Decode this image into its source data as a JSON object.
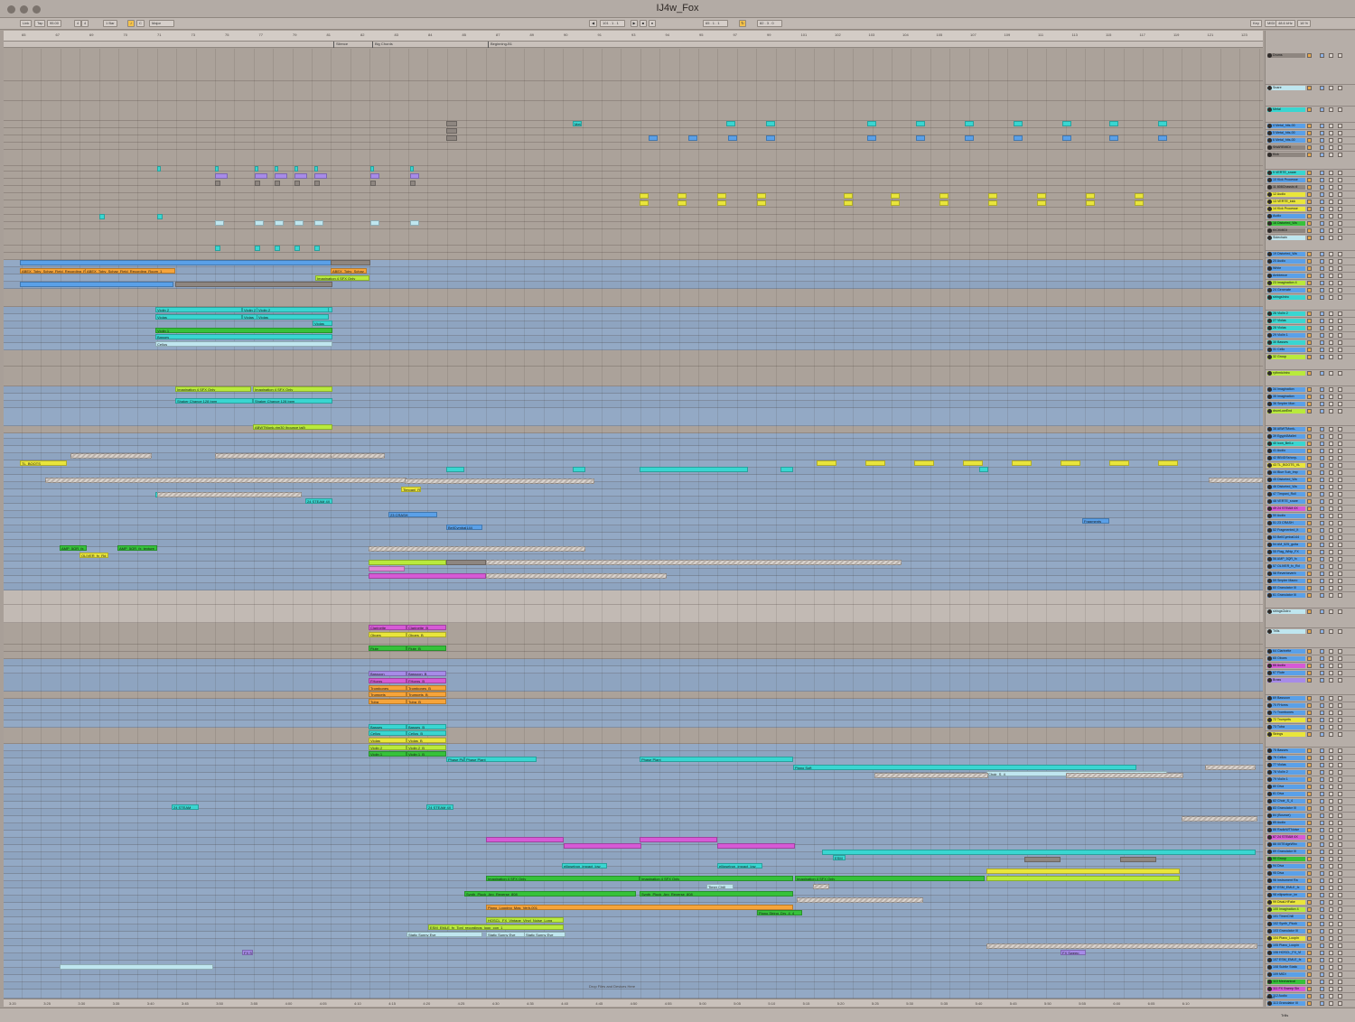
{
  "window": {
    "title": "IJ4w_Fox"
  },
  "toolbar": {
    "left": [
      "Link",
      "Tap",
      "95.00",
      "4",
      "4",
      "1 Bar",
      "C",
      "Major"
    ],
    "center": [
      "101 . 1 . 1",
      "65 . 1 . 1",
      "82 . 3 . 0"
    ],
    "right": [
      "Key",
      "MIDI",
      "48.6 kHz",
      "18 %"
    ]
  },
  "ruler": {
    "bars": [
      "65",
      "67",
      "69",
      "70",
      "71",
      "73",
      "75",
      "77",
      "79",
      "81",
      "82",
      "83",
      "84",
      "85",
      "87",
      "89",
      "90",
      "91",
      "93",
      "94",
      "95",
      "97",
      "99",
      "101",
      "102",
      "103",
      "104",
      "105",
      "107",
      "109",
      "111",
      "113",
      "115",
      "117",
      "119",
      "121",
      "123"
    ]
  },
  "locators": [
    "Silence",
    "Big Chords",
    "Beginning-B1"
  ],
  "time_labels": [
    "3:20",
    "3:25",
    "3:30",
    "3:35",
    "3:40",
    "3:45",
    "3:50",
    "3:55",
    "4:00",
    "4:05",
    "4:10",
    "4:15",
    "4:20",
    "4:25",
    "4:30",
    "4:35",
    "4:40",
    "4:45",
    "4:50",
    "4:55",
    "5:00",
    "5:05",
    "5:10",
    "5:15",
    "5:20",
    "5:25",
    "5:30",
    "5:35",
    "5:40",
    "5:45",
    "5:50",
    "5:55",
    "6:00",
    "6:05",
    "6:10"
  ],
  "drop_hint": "Drop Files and Devices Here",
  "colors": {
    "cyan": "#39d6d1",
    "blue": "#5aa0e8",
    "green": "#36c23a",
    "lime": "#b9ea3c",
    "yellow": "#e9e53b",
    "orange": "#f6a43a",
    "magenta": "#d65ad6",
    "purple": "#a78be8",
    "pale": "#bfe6ef",
    "grey": "#8e8680",
    "lane": "#8fa6c4"
  },
  "clips": [
    {
      "label": "ABEX_Toby_Schay_Field_Recording_Room_1",
      "color": "orange"
    },
    {
      "label": "ABEX_Toby_Schay_Field_Recording_Room_1",
      "color": "orange"
    },
    {
      "label": "ABEX_Toby_Schay_Fi",
      "color": "orange"
    },
    {
      "label": "Imagination 4 SFX Only",
      "color": "lime"
    },
    {
      "label": "Violin 2",
      "color": "cyan"
    },
    {
      "label": "Violin 2",
      "color": "cyan"
    },
    {
      "label": "Violin 2",
      "color": "cyan"
    },
    {
      "label": "Violas",
      "color": "cyan"
    },
    {
      "label": "Violas",
      "color": "cyan"
    },
    {
      "label": "Violas",
      "color": "cyan"
    },
    {
      "label": "Violas",
      "color": "cyan"
    },
    {
      "label": "Violin 1",
      "color": "green"
    },
    {
      "label": "Basses",
      "color": "cyan"
    },
    {
      "label": "Cellos",
      "color": "pale"
    },
    {
      "label": "Imagination 4 SFX Only",
      "color": "lime"
    },
    {
      "label": "Imagination 4 SFX Only",
      "color": "lime"
    },
    {
      "label": "Shaker Chance 128 bpm",
      "color": "cyan"
    },
    {
      "label": "Shaker Chance 128 bpm",
      "color": "cyan"
    },
    {
      "label": "ABWTMonk-rim30 (bounce tail)",
      "color": "lime"
    },
    {
      "label": "TL_BOOTS",
      "color": "yellow"
    },
    {
      "label": "Timpani_R",
      "color": "yellow"
    },
    {
      "label": "VERTE",
      "color": "cyan"
    },
    {
      "label": "24 STEAM 4X",
      "color": "cyan"
    },
    {
      "label": "23 CRASH",
      "color": "blue"
    },
    {
      "label": "BellCymbal144",
      "color": "blue"
    },
    {
      "label": "AMP_5QR_fx",
      "color": "green"
    },
    {
      "label": "AMP_5QR_fx_texture",
      "color": "green"
    },
    {
      "label": "OLIVER_fx_Rd",
      "color": "yellow"
    },
    {
      "label": "Clarinette",
      "color": "magenta"
    },
    {
      "label": "Clarinette_B",
      "color": "magenta"
    },
    {
      "label": "Oboes",
      "color": "yellow"
    },
    {
      "label": "Oboes_B",
      "color": "yellow"
    },
    {
      "label": "Flute",
      "color": "green"
    },
    {
      "label": "Flute_B",
      "color": "green"
    },
    {
      "label": "Bassoon",
      "color": "purple"
    },
    {
      "label": "Bassoon_B",
      "color": "purple"
    },
    {
      "label": "FHorns",
      "color": "magenta"
    },
    {
      "label": "FHorns_B",
      "color": "magenta"
    },
    {
      "label": "Trombones",
      "color": "orange"
    },
    {
      "label": "Trombones_B",
      "color": "orange"
    },
    {
      "label": "Trumpets",
      "color": "orange"
    },
    {
      "label": "Trumpets_B",
      "color": "orange"
    },
    {
      "label": "Tuba",
      "color": "orange"
    },
    {
      "label": "Tuba_B",
      "color": "orange"
    },
    {
      "label": "Basses",
      "color": "cyan"
    },
    {
      "label": "Basses_B",
      "color": "cyan"
    },
    {
      "label": "Cellos",
      "color": "cyan"
    },
    {
      "label": "Cellos_B",
      "color": "cyan"
    },
    {
      "label": "Violas",
      "color": "yellow"
    },
    {
      "label": "Violas_B",
      "color": "yellow"
    },
    {
      "label": "Violin 2",
      "color": "lime"
    },
    {
      "label": "Violin 2_B",
      "color": "lime"
    },
    {
      "label": "Violin 1",
      "color": "green"
    },
    {
      "label": "Violin 1_B",
      "color": "green"
    },
    {
      "label": "Phase Plan",
      "color": "cyan"
    },
    {
      "label": "Phase Plant",
      "color": "cyan"
    },
    {
      "label": "Phase Plant",
      "color": "cyan"
    },
    {
      "label": "Piano Soft",
      "color": "cyan"
    },
    {
      "label": "Choir_S_4",
      "color": "pale"
    },
    {
      "label": "24 STEAM",
      "color": "cyan"
    },
    {
      "label": "24 STEAM 4X",
      "color": "cyan"
    },
    {
      "label": "Imagination 4 SFX Only",
      "color": "green"
    },
    {
      "label": "Imagination 4 SFX Only",
      "color": "green"
    },
    {
      "label": "Imagination 4 SFX Only",
      "color": "green"
    },
    {
      "label": "Synth_Pluck_Arp_Reverse_808",
      "color": "green"
    },
    {
      "label": "Synth_Pluck_Arp_Reverse_808",
      "color": "green"
    },
    {
      "label": "Piano_Looping_Mas_Verb-001",
      "color": "orange"
    },
    {
      "label": "HOSCL_FX_Vintage_Vinyl_Noise_Long",
      "color": "lime"
    },
    {
      "label": "ESM_EMLE_fx_Tonl_recordings_loop_con_1",
      "color": "lime"
    },
    {
      "label": "Static Sunny Eve",
      "color": "pale"
    },
    {
      "label": "Static Sunny Eve",
      "color": "pale"
    },
    {
      "label": "Static Sunny Eve",
      "color": "pale"
    },
    {
      "label": "Piano String_Dry_4_4",
      "color": "green"
    },
    {
      "label": "ellipsetron_impact_low",
      "color": "cyan"
    },
    {
      "label": "ellipsetron_impact_low",
      "color": "cyan"
    },
    {
      "label": "Timer Chill",
      "color": "pale"
    },
    {
      "label": "Fragments",
      "color": "blue"
    },
    {
      "label": "Metal",
      "color": "cyan"
    },
    {
      "label": "VERT",
      "color": "yellow"
    },
    {
      "label": "ESM",
      "color": "cyan"
    },
    {
      "label": "FX Swe",
      "color": "purple"
    },
    {
      "label": "FX Sweep",
      "color": "purple"
    }
  ],
  "mixer_tracks": [
    {
      "name": "Drums",
      "color": "grey"
    },
    {
      "name": "Snare",
      "color": "pale"
    },
    {
      "name": "Metal",
      "color": "cyan"
    },
    {
      "name": "4 Metal_hits-00",
      "color": "blue"
    },
    {
      "name": "5 Metal_hits-00",
      "color": "blue"
    },
    {
      "name": "6 Metal_hits-00",
      "color": "blue"
    },
    {
      "name": "SNAREMIDI",
      "color": "grey"
    },
    {
      "name": "Kick",
      "color": "grey"
    },
    {
      "name": "9 VERTE_snare",
      "color": "cyan"
    },
    {
      "name": "10 Kick Processe",
      "color": "blue"
    },
    {
      "name": "11 808Chassis di",
      "color": "grey"
    },
    {
      "name": "12 Audio",
      "color": "yellow"
    },
    {
      "name": "13 VERTE_kick",
      "color": "yellow"
    },
    {
      "name": "14 Kick Processe",
      "color": "yellow"
    },
    {
      "name": "Audio",
      "color": "blue"
    },
    {
      "name": "16 Distorted_Wa",
      "color": "green"
    },
    {
      "name": "KICKMIDI",
      "color": "grey"
    },
    {
      "name": "Sidechain",
      "color": "pale"
    },
    {
      "name": "19 Distorted_Wa",
      "color": "blue"
    },
    {
      "name": "20 Audio",
      "color": "blue"
    },
    {
      "name": "White",
      "color": "blue"
    },
    {
      "name": "Ambience",
      "color": "blue"
    },
    {
      "name": "23 Imagination 4",
      "color": "lime"
    },
    {
      "name": "24 Generate",
      "color": "blue"
    },
    {
      "name": "stringsIntro",
      "color": "cyan"
    },
    {
      "name": "26 Violin 2",
      "color": "cyan"
    },
    {
      "name": "27 Violas",
      "color": "cyan"
    },
    {
      "name": "28 Violas",
      "color": "cyan"
    },
    {
      "name": "29 Violin 1",
      "color": "blue"
    },
    {
      "name": "30 Basses",
      "color": "cyan"
    },
    {
      "name": "31 Cello",
      "color": "blue"
    },
    {
      "name": "32 Group",
      "color": "lime"
    },
    {
      "name": "rythmicIntro",
      "color": "lime"
    },
    {
      "name": "34 Imagination",
      "color": "blue"
    },
    {
      "name": "35 Imagination",
      "color": "blue"
    },
    {
      "name": "36 Smpler Mon",
      "color": "blue"
    },
    {
      "name": "drumLowEnd",
      "color": "lime"
    },
    {
      "name": "38 ABWTMonk-",
      "color": "blue"
    },
    {
      "name": "39 Egypt4Mallet",
      "color": "blue"
    },
    {
      "name": "40 Icon_Bell-c",
      "color": "cyan"
    },
    {
      "name": "41 Audio",
      "color": "blue"
    },
    {
      "name": "42 BB4DSshorp-",
      "color": "blue"
    },
    {
      "name": "43 TL_BOOTS_VL",
      "color": "yellow"
    },
    {
      "name": "44 Blue Sub_Imp",
      "color": "blue"
    },
    {
      "name": "45 Distorted_Wa",
      "color": "blue"
    },
    {
      "name": "46 Distorted_Wa",
      "color": "blue"
    },
    {
      "name": "47 Timpani_Roll",
      "color": "blue"
    },
    {
      "name": "48 VERTE_snare",
      "color": "blue"
    },
    {
      "name": "49 24 STEAM 4X",
      "color": "magenta"
    },
    {
      "name": "50 Audio",
      "color": "blue"
    },
    {
      "name": "51 23 CRASH",
      "color": "blue"
    },
    {
      "name": "52 Fragmented_It",
      "color": "blue"
    },
    {
      "name": "53 BellCymbal144",
      "color": "blue"
    },
    {
      "name": "54 AM_525_guita",
      "color": "blue"
    },
    {
      "name": "55 Flag_Whip_FX",
      "color": "blue"
    },
    {
      "name": "56 AMP_5QR_fx",
      "color": "blue"
    },
    {
      "name": "57 OLIVER_fx_Rd",
      "color": "blue"
    },
    {
      "name": "58 Reverbeverb",
      "color": "blue"
    },
    {
      "name": "59 Smpler Macro",
      "color": "blue"
    },
    {
      "name": "60 Granulator III",
      "color": "blue"
    },
    {
      "name": "61 Granulator III",
      "color": "blue"
    },
    {
      "name": "stringsOutro",
      "color": "pale"
    },
    {
      "name": "Trills",
      "color": "pale"
    },
    {
      "name": "64 Clarinette",
      "color": "blue"
    },
    {
      "name": "65 Oboes",
      "color": "blue"
    },
    {
      "name": "66 Audio",
      "color": "magenta"
    },
    {
      "name": "67 Flute",
      "color": "blue"
    },
    {
      "name": "Brass",
      "color": "purple"
    },
    {
      "name": "69 Bassoon",
      "color": "blue"
    },
    {
      "name": "70 FHorns",
      "color": "blue"
    },
    {
      "name": "71 Trombones",
      "color": "blue"
    },
    {
      "name": "72 Trumpets",
      "color": "yellow"
    },
    {
      "name": "73 Tuba",
      "color": "blue"
    },
    {
      "name": "Strings",
      "color": "yellow"
    },
    {
      "name": "75 Basses",
      "color": "blue"
    },
    {
      "name": "76 Cellos",
      "color": "blue"
    },
    {
      "name": "77 Violas",
      "color": "blue"
    },
    {
      "name": "78 Violin 2",
      "color": "blue"
    },
    {
      "name": "79 Violin 1",
      "color": "blue"
    },
    {
      "name": "80 Diva",
      "color": "blue"
    },
    {
      "name": "81 Diva",
      "color": "blue"
    },
    {
      "name": "82 Choir_S_4",
      "color": "blue"
    },
    {
      "name": "83 Granulator III",
      "color": "blue"
    },
    {
      "name": "84 (Bounce)",
      "color": "blue"
    },
    {
      "name": "85 Audio",
      "color": "blue"
    },
    {
      "name": "86 RadioWTNoise",
      "color": "blue"
    },
    {
      "name": "87 24 STEAM 4X",
      "color": "magenta"
    },
    {
      "name": "88 00TEdgeWhx",
      "color": "blue"
    },
    {
      "name": "89 Granulator III",
      "color": "blue"
    },
    {
      "name": "90 Group",
      "color": "green"
    },
    {
      "name": "94 Diva",
      "color": "blue"
    },
    {
      "name": "95 Diva",
      "color": "blue"
    },
    {
      "name": "96 Instrument Ra",
      "color": "blue"
    },
    {
      "name": "97 ESM_EMLE_fx",
      "color": "blue"
    },
    {
      "name": "98 ellipsetron_im",
      "color": "blue"
    },
    {
      "name": "99 DivaLHFake",
      "color": "yellow"
    },
    {
      "name": "100 Imagination 4",
      "color": "lime"
    },
    {
      "name": "101 TimerChill",
      "color": "blue"
    },
    {
      "name": "102 Synth_Pluck",
      "color": "blue"
    },
    {
      "name": "103 Granulator III",
      "color": "blue"
    },
    {
      "name": "104 Piano_Loopin",
      "color": "yellow"
    },
    {
      "name": "105 Piano_Loopin",
      "color": "blue"
    },
    {
      "name": "106 HOSCL_FX_Vi",
      "color": "blue"
    },
    {
      "name": "107 ESM_EMLE_fx",
      "color": "blue"
    },
    {
      "name": "108 Subtle Static",
      "color": "blue"
    },
    {
      "name": "109 MIDI",
      "color": "blue"
    },
    {
      "name": "110 Mechanical",
      "color": "green"
    },
    {
      "name": "111 FX Sweep Sin",
      "color": "magenta"
    },
    {
      "name": "112 Audio",
      "color": "blue"
    },
    {
      "name": "113 Granulator III",
      "color": "blue"
    },
    {
      "name": "114 Audio",
      "color": "blue"
    }
  ],
  "main_track": "Main",
  "status": {
    "track": "Trills"
  }
}
